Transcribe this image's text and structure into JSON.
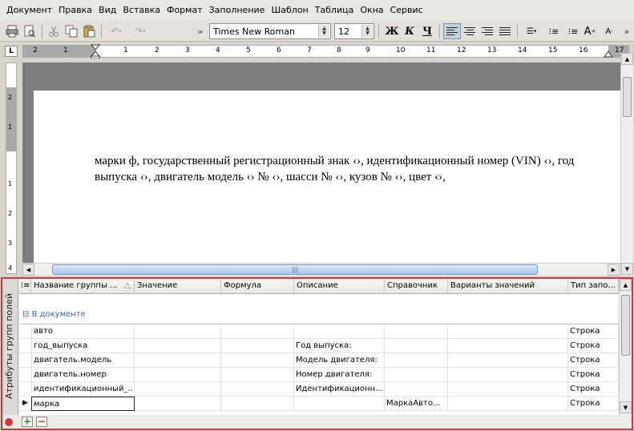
{
  "menu": [
    "Документ",
    "Правка",
    "Вид",
    "Вставка",
    "Формат",
    "Заполнение",
    "Шаблон",
    "Таблица",
    "Окна",
    "Сервис"
  ],
  "toolbar": {
    "font_name": "Times New Roman",
    "font_size": "12",
    "bold": "Ж",
    "italic": "К",
    "underline": "Ч",
    "grow_font": "A",
    "shrink_font": "A"
  },
  "ruler": {
    "corner": "L",
    "h_numbers": [
      "2",
      "1",
      "1",
      "2",
      "3",
      "4",
      "5",
      "6",
      "7",
      "8",
      "9",
      "10",
      "11",
      "12",
      "13",
      "14",
      "15",
      "16",
      "17"
    ],
    "v_numbers": [
      "2",
      "1",
      "1",
      "2",
      "3",
      "4"
    ]
  },
  "document": {
    "line1": "марки ф, государственный регистрационный знак ‹›, идентификационный номер (VIN) ‹›, год",
    "line2": "выпуска ‹›, двигатель модель ‹› № ‹›, шасси № ‹›, кузов № ‹›, цвет ‹›,"
  },
  "panel": {
    "side_title": "Атрибуты групп полей",
    "columns": [
      "Название группы ...",
      "Значение",
      "Формула",
      "Описание",
      "Справочник",
      "Варианты значений",
      "Тип запо..."
    ],
    "group_label": "В документе",
    "rows": [
      {
        "name": "авто",
        "value": "",
        "formula": "",
        "description": "",
        "dictionary": "",
        "variants": "",
        "type": "Строка"
      },
      {
        "name": "год_выпуска",
        "value": "",
        "formula": "",
        "description": "Год выпуска:",
        "dictionary": "",
        "variants": "",
        "type": "Строка"
      },
      {
        "name": "двигатель.модель",
        "value": "",
        "formula": "",
        "description": "Модель двигателя:",
        "dictionary": "",
        "variants": "",
        "type": "Строка"
      },
      {
        "name": "двигатель.номер",
        "value": "",
        "formula": "",
        "description": "Номер двигателя:",
        "dictionary": "",
        "variants": "",
        "type": "Строка"
      },
      {
        "name": "идентификационный_...",
        "value": "",
        "formula": "",
        "description": "Идентификационн...",
        "dictionary": "",
        "variants": "",
        "type": "Строка"
      },
      {
        "name": "марка",
        "value": "",
        "formula": "",
        "description": "",
        "dictionary": "МаркаАвто...",
        "variants": "",
        "type": "Строка"
      }
    ],
    "add_button": "+",
    "remove_button": "−"
  },
  "colors": {
    "panel_border": "#d2363c",
    "group_text": "#2c63b8",
    "scroll_thumb": "#a8c8ec"
  }
}
